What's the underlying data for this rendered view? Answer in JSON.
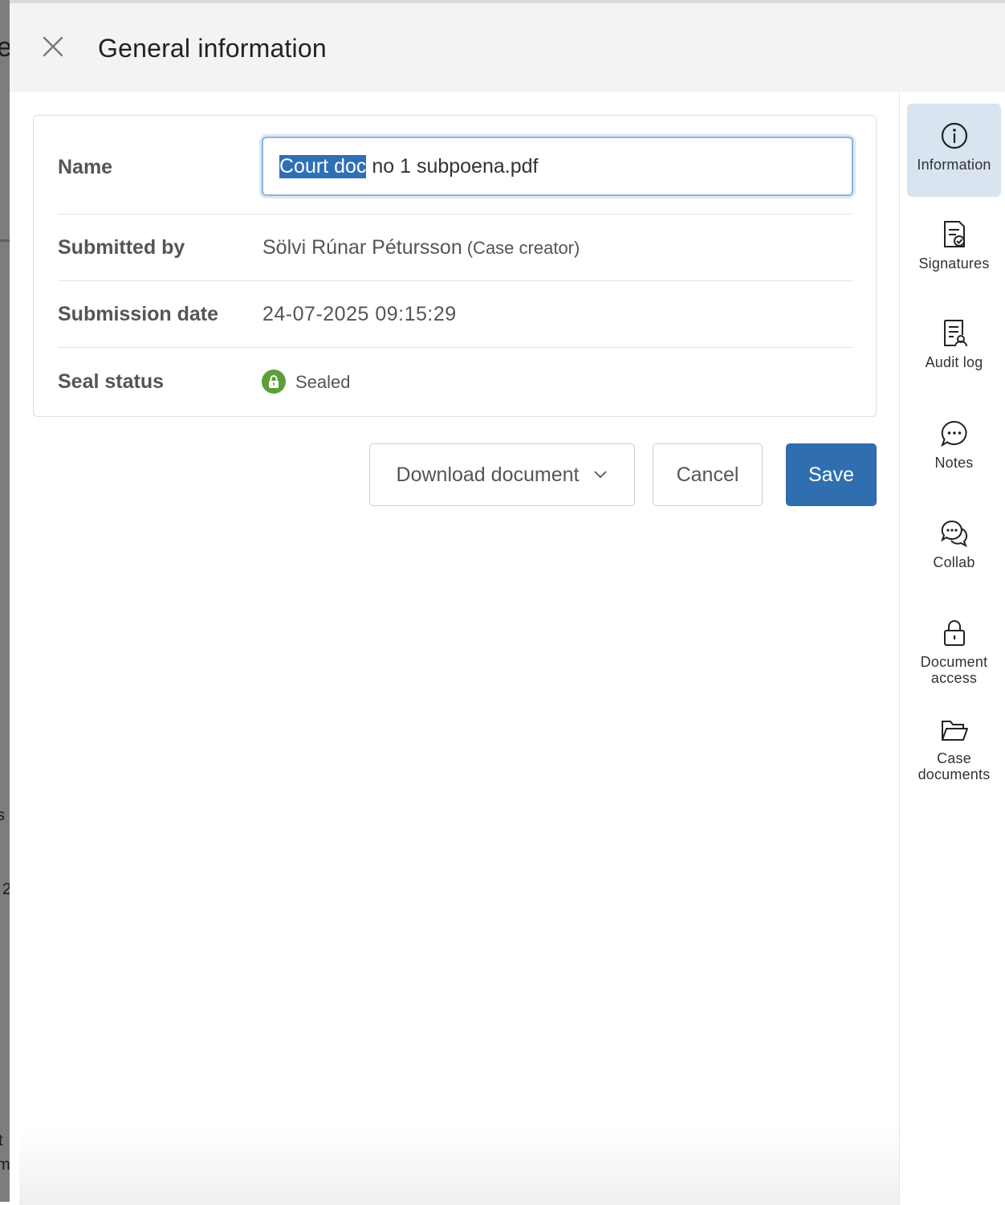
{
  "header": {
    "title": "General information",
    "close_label": "Close"
  },
  "background_fragments": {
    "f1": "e",
    "f2": "s",
    "f3": "2",
    "f4": "t",
    "f5": "m"
  },
  "info": {
    "name": {
      "label": "Name",
      "value_selected": "Court doc",
      "value_rest": " no 1 subpoena.pdf"
    },
    "submitted_by": {
      "label": "Submitted by",
      "value": "Sölvi Rúnar Pétursson",
      "role": "(Case creator)"
    },
    "submission_date": {
      "label": "Submission date",
      "value": "24-07-2025 09:15:29"
    },
    "seal_status": {
      "label": "Seal status",
      "value": "Sealed",
      "color": "#5c9f3a"
    }
  },
  "actions": {
    "download_label": "Download document",
    "cancel_label": "Cancel",
    "save_label": "Save",
    "save_color": "#2f6fb0"
  },
  "rail": {
    "active_tab": "Information",
    "active_color": "#d8e4ef",
    "tabs": [
      {
        "label": "Information",
        "icon": "info-icon"
      },
      {
        "label": "Signatures",
        "icon": "signature-document-icon"
      },
      {
        "label": "Audit log",
        "icon": "audit-document-icon"
      },
      {
        "label": "Notes",
        "icon": "chat-bubble-icon"
      },
      {
        "label": "Collab",
        "icon": "double-chat-icon"
      },
      {
        "label": "Document access",
        "icon": "lock-icon"
      },
      {
        "label": "Case documents",
        "icon": "folder-open-icon"
      }
    ]
  }
}
